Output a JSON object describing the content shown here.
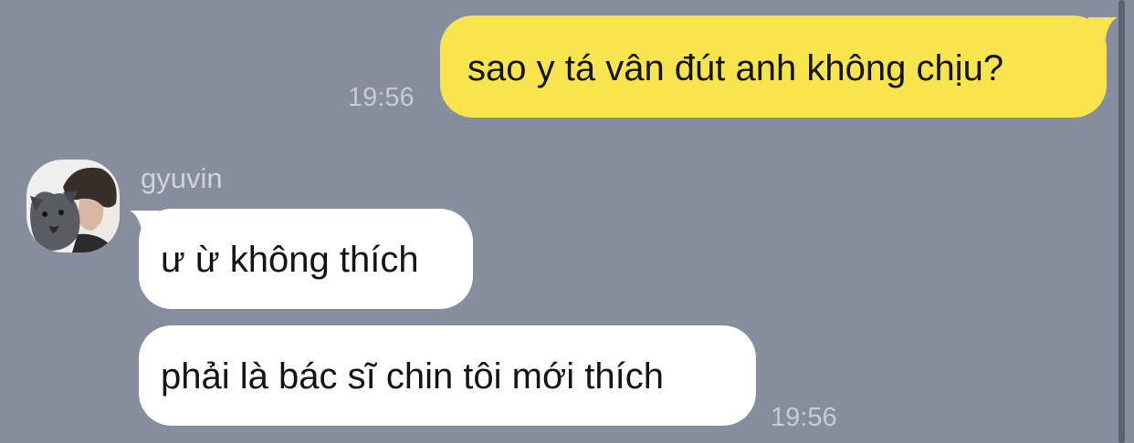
{
  "messages": [
    {
      "direction": "outgoing",
      "text": "sao y tá vân đút anh không chịu?",
      "time": "19:56"
    },
    {
      "direction": "incoming",
      "sender": "gyuvin",
      "text": "ư ừ không thích"
    },
    {
      "direction": "incoming",
      "sender": "gyuvin",
      "text": "phải là bác sĩ chin tôi mới thích",
      "time": "19:56"
    }
  ],
  "colors": {
    "background": "#868d9d",
    "outgoing_bubble": "#f7e44f",
    "incoming_bubble": "#ffffff",
    "timestamp": "#c7cbd3"
  },
  "icons": {
    "avatar": "profile-photo-person-with-dog"
  }
}
